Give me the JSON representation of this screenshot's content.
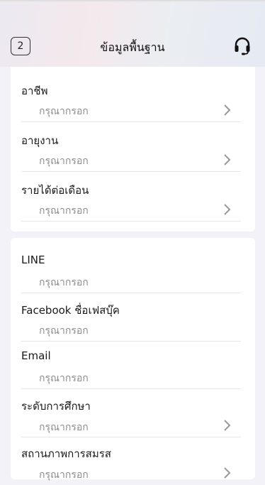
{
  "header": {
    "step": "2",
    "title": "ข้อมูลพื้นฐาน"
  },
  "section1": {
    "fields": [
      {
        "label": "อาชีพ",
        "placeholder": "กรุณากรอก"
      },
      {
        "label": "อายุงาน",
        "placeholder": "กรุณากรอก"
      },
      {
        "label": "รายได้ต่อเดือน",
        "placeholder": "กรุณากรอก"
      }
    ]
  },
  "section2": {
    "fields": [
      {
        "label": "LINE",
        "placeholder": "กรุณากรอก"
      },
      {
        "label": "Facebook ชื่อเฟสบุ๊ค",
        "placeholder": "กรุณากรอก"
      },
      {
        "label": "Email",
        "placeholder": "กรุณากรอก"
      },
      {
        "label": "ระดับการศึกษา",
        "placeholder": "กรุณากรอก"
      },
      {
        "label": "สถานภาพการสมรส",
        "placeholder": "กรุณากรอก"
      }
    ]
  },
  "icons": {
    "support": "headset-icon",
    "chevron": "chevron-right-icon"
  },
  "colors": {
    "placeholder": "#8c8c8c",
    "chevron": "#999999",
    "background": "#f3f2f9"
  }
}
